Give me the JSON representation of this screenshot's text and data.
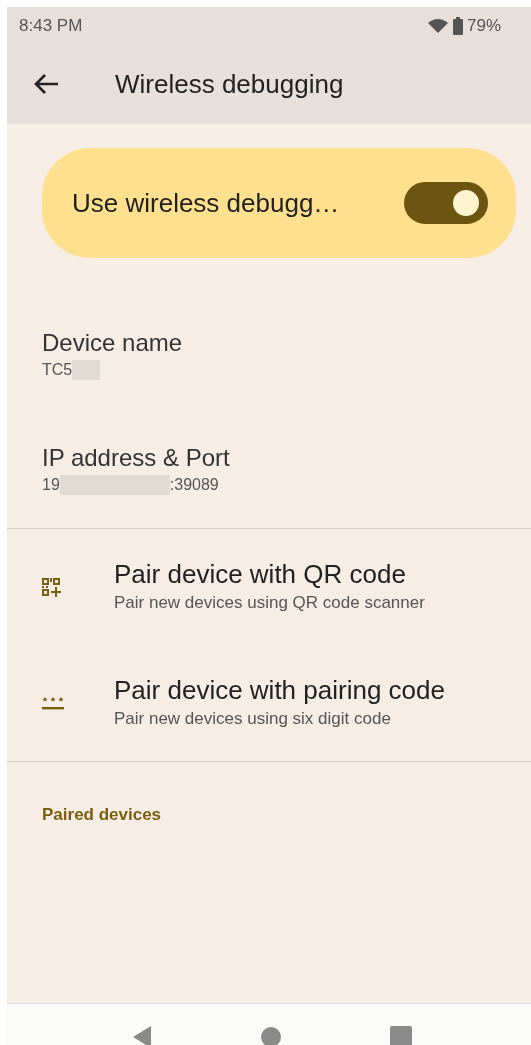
{
  "status_bar": {
    "time": "8:43 PM",
    "battery": "79%"
  },
  "app_bar": {
    "title": "Wireless debugging"
  },
  "main_toggle": {
    "label": "Use wireless debugg…",
    "on": true
  },
  "info_items": [
    {
      "title": "Device name",
      "value_start": "TC5",
      "redacted": true
    },
    {
      "title": "IP address & Port",
      "value_start": "19",
      "value_end": ":39089",
      "redacted": true
    }
  ],
  "actions": [
    {
      "kind": "qr",
      "title": "Pair device with QR code",
      "subtitle": "Pair new devices using QR code scanner"
    },
    {
      "kind": "code",
      "title": "Pair device with pairing code",
      "subtitle": "Pair new devices using six digit code"
    }
  ],
  "section": {
    "header": "Paired devices"
  }
}
